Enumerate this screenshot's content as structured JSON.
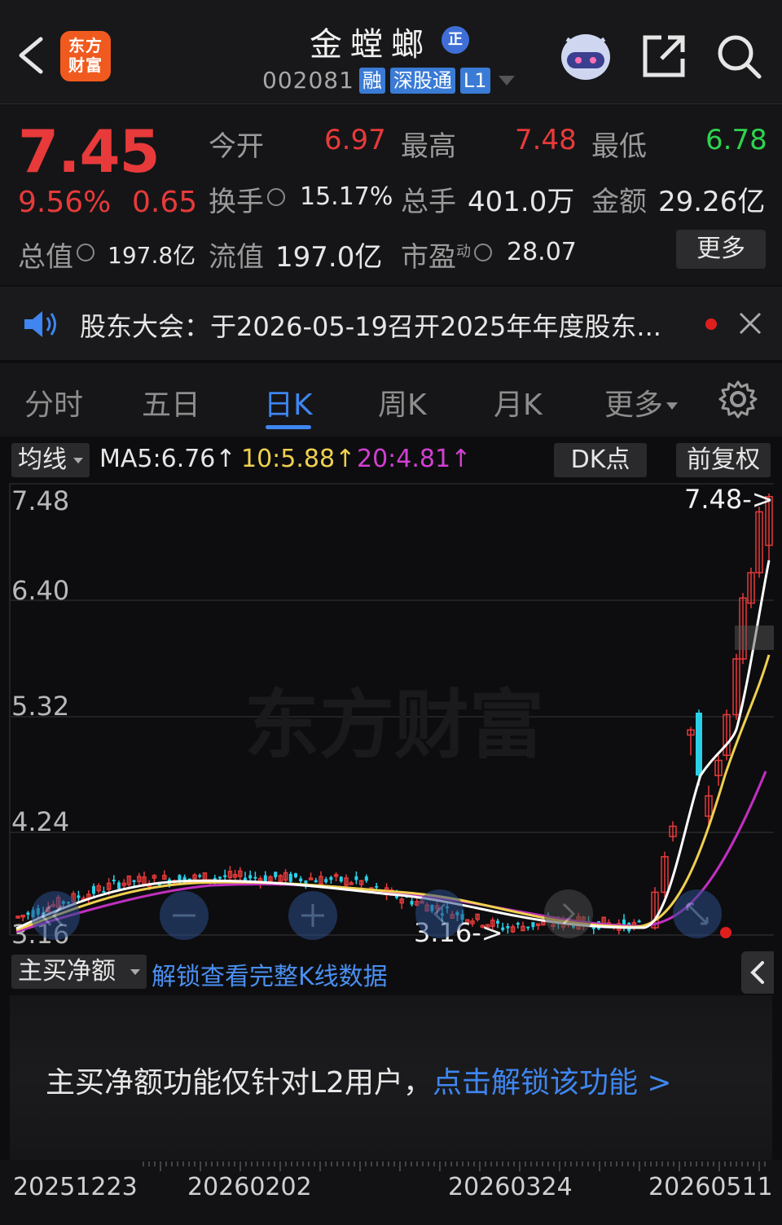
{
  "header": {
    "brand_logo_text": "东方财富",
    "stock_name": "金螳螂",
    "badge": "正",
    "code": "002081",
    "tags": [
      "融",
      "深股通",
      "L1"
    ],
    "icons": [
      "back-icon",
      "robot-icon",
      "share-icon",
      "search-icon"
    ]
  },
  "quote": {
    "price": "7.45",
    "change_pct": "9.56%",
    "change": "0.65",
    "open_label": "今开",
    "open": "6.97",
    "high_label": "最高",
    "high": "7.48",
    "low_label": "最低",
    "low": "6.78",
    "turnover_label": "换手",
    "turnover": "15.17%",
    "volume_label": "总手",
    "volume": "401.0万",
    "amount_label": "金额",
    "amount": "29.26亿",
    "mktcap_label": "总值",
    "mktcap": "197.8亿",
    "float_label": "流值",
    "float": "197.0亿",
    "pe_label": "市盈",
    "pe_sup": "动",
    "pe": "28.07",
    "more": "更多",
    "up_color": "#e83a3a",
    "down_color": "#2fd34f"
  },
  "notice": {
    "text": "股东大会：于2026-05-19召开2025年年度股东..."
  },
  "tabs": {
    "items": [
      "分时",
      "五日",
      "日K",
      "周K",
      "月K",
      "更多"
    ],
    "active": "日K"
  },
  "ma_bar": {
    "select": "均线",
    "ma5": "MA5:6.76↑",
    "ma10": "10:5.88↑",
    "ma20": "20:4.81↑",
    "dk": "DK点",
    "adjust": "前复权"
  },
  "chart_data": {
    "type": "candlestick",
    "y_ticks": [
      "7.48",
      "6.40",
      "5.32",
      "4.24",
      "3.16"
    ],
    "max_marker": "7.48->",
    "min_marker": "3.16->",
    "watermark": "东方财富",
    "ylim": [
      3.16,
      7.48
    ],
    "ma_colors": {
      "ma5": "#ffffff",
      "ma10": "#f0d050",
      "ma20": "#c030c0"
    },
    "recent_candles": [
      {
        "open": 3.2,
        "close": 3.55,
        "high": 3.6,
        "low": 3.18
      },
      {
        "open": 3.55,
        "close": 3.9,
        "high": 3.95,
        "low": 3.5
      },
      {
        "open": 4.1,
        "close": 4.2,
        "high": 4.25,
        "low": 4.05
      },
      {
        "open": 5.1,
        "close": 5.15,
        "high": 5.18,
        "low": 4.9
      },
      {
        "open": 5.32,
        "close": 4.7,
        "high": 5.35,
        "low": 4.6
      },
      {
        "open": 4.3,
        "close": 4.5,
        "high": 4.6,
        "low": 4.2
      },
      {
        "open": 4.7,
        "close": 4.85,
        "high": 4.9,
        "low": 4.6
      },
      {
        "open": 4.9,
        "close": 5.3,
        "high": 5.35,
        "low": 4.85
      },
      {
        "open": 5.3,
        "close": 5.85,
        "high": 5.9,
        "low": 5.25
      },
      {
        "open": 5.85,
        "close": 6.45,
        "high": 6.5,
        "low": 5.8
      },
      {
        "open": 6.4,
        "close": 6.7,
        "high": 6.75,
        "low": 6.35
      },
      {
        "open": 6.7,
        "close": 7.3,
        "high": 7.35,
        "low": 6.65
      },
      {
        "open": 6.97,
        "close": 7.45,
        "high": 7.48,
        "low": 6.78
      }
    ],
    "x_ticks": [
      "20251223",
      "20260202",
      "20260324",
      "20260511"
    ]
  },
  "sub_indicator": {
    "select": "主买净额",
    "unlock": "解锁查看完整K线数据",
    "promo_text": "主买净额功能仅针对L2用户，",
    "promo_link": "点击解锁该功能 >"
  }
}
